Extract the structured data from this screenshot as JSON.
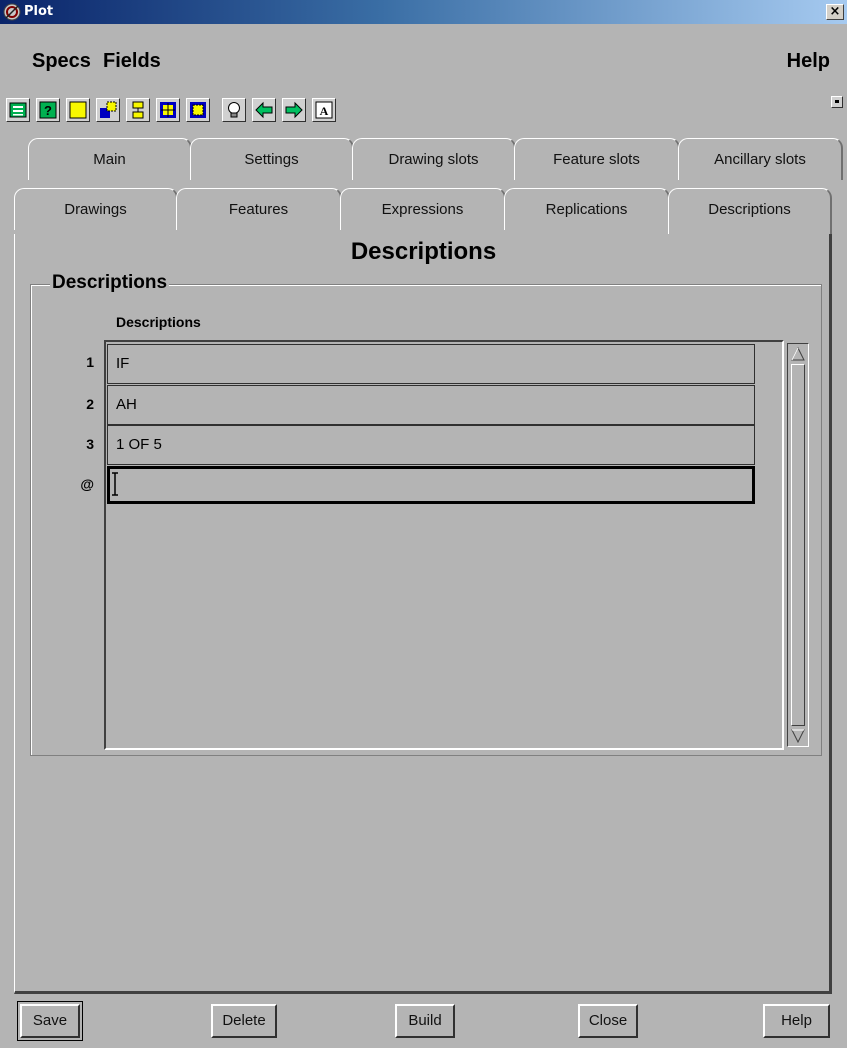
{
  "window": {
    "title": "Plot",
    "close_glyph": "×"
  },
  "menu": {
    "specs": "Specs",
    "fields": "Fields",
    "help": "Help"
  },
  "toolbar": {
    "buttons": [
      "list-icon",
      "help-question-icon",
      "yellow-square-icon",
      "move-block-icon",
      "align-icon",
      "expand-icon",
      "select-icon",
      "bulb-icon",
      "arrow-left-icon",
      "arrow-right-icon",
      "text-field-icon"
    ]
  },
  "tabs": {
    "row1": [
      "Main",
      "Settings",
      "Drawing slots",
      "Feature slots",
      "Ancillary slots"
    ],
    "row2": [
      "Drawings",
      "Features",
      "Expressions",
      "Replications",
      "Descriptions"
    ],
    "active": "Descriptions"
  },
  "panel": {
    "heading": "Descriptions",
    "group_label": "Descriptions",
    "column_header": "Descriptions",
    "rows": [
      {
        "num": "1",
        "value": "IF"
      },
      {
        "num": "2",
        "value": "AH"
      },
      {
        "num": "3",
        "value": "1 OF 5"
      }
    ],
    "new_row_marker": "@",
    "new_row_value": ""
  },
  "buttons": {
    "save": "Save",
    "delete": "Delete",
    "build": "Build",
    "close": "Close",
    "help": "Help"
  },
  "colors": {
    "background": "#b4b4b4",
    "titlebar": "#0a246a",
    "icon_yellow": "#f8f800",
    "icon_green": "#00b050",
    "icon_blue": "#0000c0"
  }
}
